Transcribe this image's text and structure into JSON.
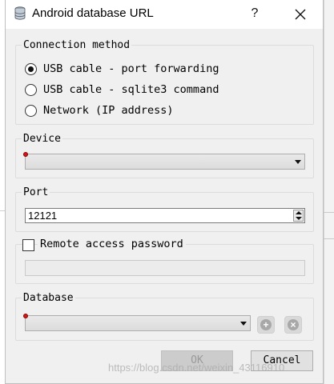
{
  "window": {
    "title": "Android database URL",
    "help_label": "?"
  },
  "connection": {
    "group_title": "Connection method",
    "options": [
      {
        "label": "USB cable - port forwarding",
        "selected": true
      },
      {
        "label": "USB cable - sqlite3 command",
        "selected": false
      },
      {
        "label": "Network (IP address)",
        "selected": false
      }
    ]
  },
  "device": {
    "group_title": "Device",
    "value": ""
  },
  "port": {
    "group_title": "Port",
    "value": "12121"
  },
  "remote_access": {
    "label": "Remote access password",
    "checked": false,
    "value": ""
  },
  "database": {
    "group_title": "Database",
    "value": "",
    "add_label": "+",
    "remove_label": "×"
  },
  "buttons": {
    "ok": "OK",
    "cancel": "Cancel"
  },
  "watermark": "https://blog.csdn.net/weixin_43116910",
  "colors": {
    "warning": "#d11818",
    "disabled_text": "#9a9a9a"
  },
  "icons": [
    "database-icon",
    "close-icon",
    "warning-icon",
    "chevron-down-icon",
    "add-icon",
    "remove-icon"
  ]
}
